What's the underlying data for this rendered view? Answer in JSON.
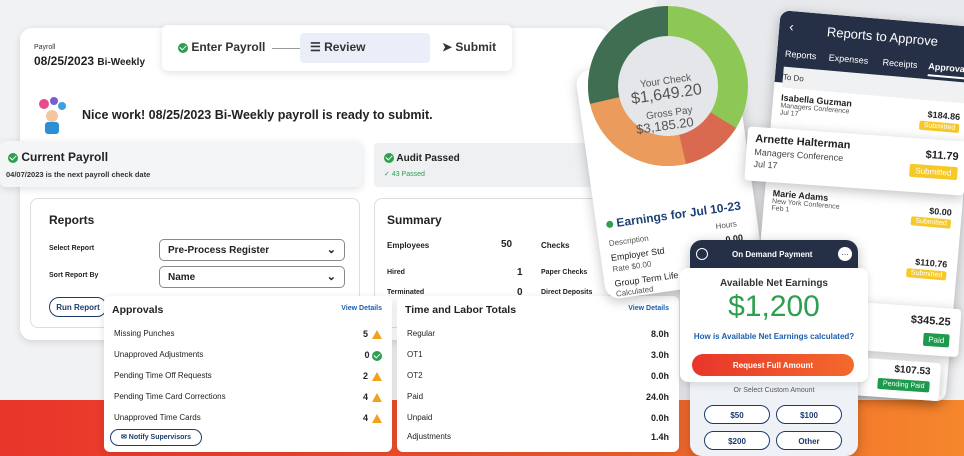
{
  "colors": {
    "accent": "#1b5fae",
    "success": "#2e9e4f",
    "warning": "#f0a31a",
    "badge_yellow": "#f7c927",
    "donut_dark_green": "#3f6e53",
    "donut_light_green": "#8dc856",
    "donut_orange": "#eb9b5c",
    "donut_red": "#d9694f",
    "orange_bar": "#f0562c"
  },
  "payroll": {
    "label": "Payroll",
    "date": "08/25/2023",
    "type": "Bi-Weekly"
  },
  "steps": [
    {
      "label": "Enter Payroll",
      "icon": "check-circle-icon"
    },
    {
      "label": "Review",
      "icon": "list-icon"
    },
    {
      "label": "Submit",
      "icon": "send-arrow-icon"
    }
  ],
  "banner": {
    "text": "Nice work! 08/25/2023 Bi-Weekly payroll is ready to submit.",
    "icon": "celebration-balloons-icon"
  },
  "current_payroll": {
    "title": "Current Payroll",
    "subtitle": "04/07/2023 is the next payroll check date"
  },
  "audit": {
    "title": "Audit Passed",
    "sub": "✓ 43 Passed"
  },
  "reports": {
    "title": "Reports",
    "select_label": "Select Report",
    "select_value": "Pre-Process Register",
    "sort_label": "Sort Report By",
    "sort_value": "Name",
    "run_button": "Run Report"
  },
  "summary": {
    "title": "Summary",
    "employees_label": "Employees",
    "employees_value": "50",
    "checks_label": "Checks",
    "rows": [
      {
        "label": "Hired",
        "value": "1",
        "right": "Paper Checks"
      },
      {
        "label": "Terminated",
        "value": "0",
        "right": "Direct Deposits"
      }
    ]
  },
  "approvals": {
    "title": "Approvals",
    "view": "View Details",
    "rows": [
      {
        "label": "Missing Punches",
        "value": "5",
        "status": "warn"
      },
      {
        "label": "Unapproved Adjustments",
        "value": "0",
        "status": "ok"
      },
      {
        "label": "Pending Time Off Requests",
        "value": "2",
        "status": "warn"
      },
      {
        "label": "Pending Time Card Corrections",
        "value": "4",
        "status": "warn"
      },
      {
        "label": "Unapproved Time Cards",
        "value": "4",
        "status": "warn"
      }
    ],
    "notify_button": "Notify Supervisors"
  },
  "time_labor": {
    "title": "Time and Labor Totals",
    "view": "View Details",
    "rows": [
      {
        "label": "Regular",
        "value": "8.0h"
      },
      {
        "label": "OT1",
        "value": "3.0h"
      },
      {
        "label": "OT2",
        "value": "0.0h"
      },
      {
        "label": "Paid",
        "value": "24.0h"
      },
      {
        "label": "Unpaid",
        "value": "0.0h"
      },
      {
        "label": "Adjustments",
        "value": "1.4h"
      }
    ]
  },
  "donut": {
    "your_check_label": "Your Check",
    "your_check": "$1,649.20",
    "gross_label": "Gross Pay",
    "gross": "$3,185.20"
  },
  "earnings": {
    "title": "Earnings for Jul 10-23",
    "col1": "Description",
    "col2": "Hours",
    "r1": "Employer Std",
    "r1b": "Rate $0.00",
    "r2": "Group Term Life",
    "r2b": "Calculated",
    "amount": "0.00"
  },
  "reports_approve": {
    "title": "Reports to Approve",
    "tabs": [
      "Reports",
      "Expenses",
      "Receipts",
      "Approvals"
    ],
    "todo": "To Do",
    "items": [
      {
        "name": "Isabella Guzman",
        "desc": "Managers Conference",
        "date": "Jul 17",
        "amount": "$184.86",
        "status": "Submitted"
      },
      {
        "name": "Arnette Halterman",
        "desc": "Managers Conference",
        "date": "Jul 17",
        "amount": "$11.79",
        "status": "Submitted"
      },
      {
        "name": "Marie Adams",
        "desc": "New York Conference",
        "date": "Feb 1",
        "amount": "$0.00",
        "status": "Submitted"
      },
      {
        "name": "",
        "desc": "",
        "date": "",
        "amount": "$110.76",
        "status": "Submitted"
      },
      {
        "name": "",
        "desc": "",
        "date": "",
        "amount": "$345.25",
        "status": "Paid"
      },
      {
        "name": "",
        "desc": "",
        "date": "",
        "amount": "$107.53",
        "status": "Pending Paid"
      }
    ]
  },
  "on_demand": {
    "title": "On Demand Payment",
    "available_label": "Available Net Earnings",
    "amount": "$1,200",
    "question": "How is Available Net Earnings calculated?",
    "request_button": "Request Full Amount",
    "custom_label": "Or Select Custom Amount",
    "options": [
      "$50",
      "$100",
      "$200",
      "Other"
    ]
  }
}
